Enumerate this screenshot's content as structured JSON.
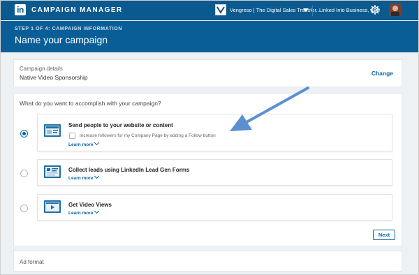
{
  "colors": {
    "brand": "#0b5a8f",
    "header": "#0a5e97",
    "accent": "#0a66a8",
    "annotation_arrow": "#5b8fd0"
  },
  "topbar": {
    "logo_text": "in",
    "title": "CAMPAIGN MANAGER",
    "account_name": "Vengreso | The Digital Sales Transfor...",
    "linked_account": "Linked Into Business, LLC",
    "icons": [
      "linkedin-logo-icon",
      "caret-down-icon",
      "gear-icon",
      "user-avatar"
    ]
  },
  "header": {
    "step": "STEP 1 OF 4: CAMPAIGN INFORMATION",
    "title": "Name your campaign"
  },
  "details": {
    "label": "Campaign details",
    "value": "Native Video Sponsorship",
    "change_label": "Change"
  },
  "objective": {
    "question": "What do you want to accomplish with your campaign?",
    "options": [
      {
        "title": "Send people to your website or content",
        "checkbox_label": "Increase followers for my Company Page by adding a Follow button",
        "learn_more": "Learn more",
        "selected": true,
        "icon": "website-icon"
      },
      {
        "title": "Collect leads using LinkedIn Lead Gen Forms",
        "learn_more": "Learn more",
        "selected": false,
        "icon": "lead-form-icon"
      },
      {
        "title": "Get Video Views",
        "learn_more": "Learn more",
        "selected": false,
        "icon": "video-icon"
      }
    ],
    "next_label": "Next"
  },
  "ad_format": {
    "label": "Ad format"
  }
}
